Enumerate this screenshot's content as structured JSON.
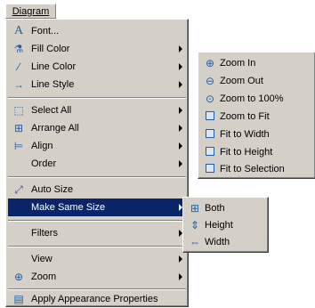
{
  "menubar": {
    "label": "Diagram"
  },
  "main_menu": {
    "items": [
      {
        "label": "Font...",
        "icon": "font-icon",
        "submenu": false
      },
      {
        "label": "Fill Color",
        "icon": "fill-color-icon",
        "submenu": true
      },
      {
        "label": "Line Color",
        "icon": "line-color-icon",
        "submenu": true
      },
      {
        "label": "Line Style",
        "icon": "line-style-icon",
        "submenu": true
      },
      {
        "label": "Select All",
        "icon": "select-all-icon",
        "submenu": true
      },
      {
        "label": "Arrange All",
        "icon": "arrange-all-icon",
        "submenu": true
      },
      {
        "label": "Align",
        "icon": "align-icon",
        "submenu": true
      },
      {
        "label": "Order",
        "icon": "",
        "submenu": true
      },
      {
        "label": "Auto Size",
        "icon": "auto-size-icon",
        "submenu": false
      },
      {
        "label": "Make Same Size",
        "icon": "",
        "submenu": true
      },
      {
        "label": "Filters",
        "icon": "",
        "submenu": true
      },
      {
        "label": "View",
        "icon": "",
        "submenu": true
      },
      {
        "label": "Zoom",
        "icon": "zoom-icon",
        "submenu": true
      },
      {
        "label": "Apply Appearance Properties",
        "icon": "apply-appearance-icon",
        "submenu": false
      }
    ]
  },
  "zoom_menu": {
    "items": [
      {
        "label": "Zoom In",
        "icon": "zoom-in-icon"
      },
      {
        "label": "Zoom Out",
        "icon": "zoom-out-icon"
      },
      {
        "label": "Zoom to 100%",
        "icon": "zoom-100-icon"
      },
      {
        "label": "Zoom to Fit",
        "icon": "zoom-fit-icon"
      },
      {
        "label": "Fit to Width",
        "icon": "fit-width-icon"
      },
      {
        "label": "Fit to Height",
        "icon": "fit-height-icon"
      },
      {
        "label": "Fit to Selection",
        "icon": "fit-selection-icon"
      }
    ]
  },
  "size_menu": {
    "items": [
      {
        "label": "Both",
        "icon": "same-size-both-icon"
      },
      {
        "label": "Height",
        "icon": "same-height-icon"
      },
      {
        "label": "Width",
        "icon": "same-width-icon"
      }
    ]
  },
  "colors": {
    "menu_bg": "#d4d0c8",
    "selection": "#0a246a",
    "icon": "#1f5ea8"
  }
}
